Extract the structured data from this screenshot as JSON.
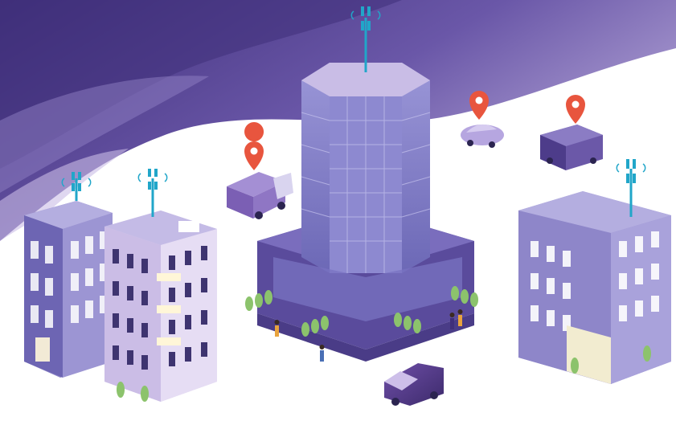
{
  "scene": {
    "colors": {
      "sky_dark": "#3f2f7a",
      "sky_mid": "#6a57a8",
      "sky_light": "#b7a9d9",
      "ground": "#ffffff",
      "building_main": "#8e86c9",
      "building_dark": "#5a4b9c",
      "building_light": "#d9cfee",
      "glass": "#7f7cc4",
      "antenna": "#21a6c9",
      "pin": "#e8553e",
      "tree": "#8cc36c",
      "van_dark": "#5b3f8f"
    },
    "elements": {
      "towers": [
        "cell-tower-left",
        "cell-tower-center",
        "cell-tower-right",
        "cell-tower-left2"
      ],
      "pins": [
        "location-pin-truck",
        "location-pin-car",
        "location-pin-van"
      ],
      "vehicles": [
        "delivery-truck",
        "small-car",
        "cargo-van",
        "minivan"
      ],
      "buildings": [
        "left-apartment",
        "left-apartment-2",
        "central-skyscraper",
        "right-apartment"
      ]
    }
  }
}
